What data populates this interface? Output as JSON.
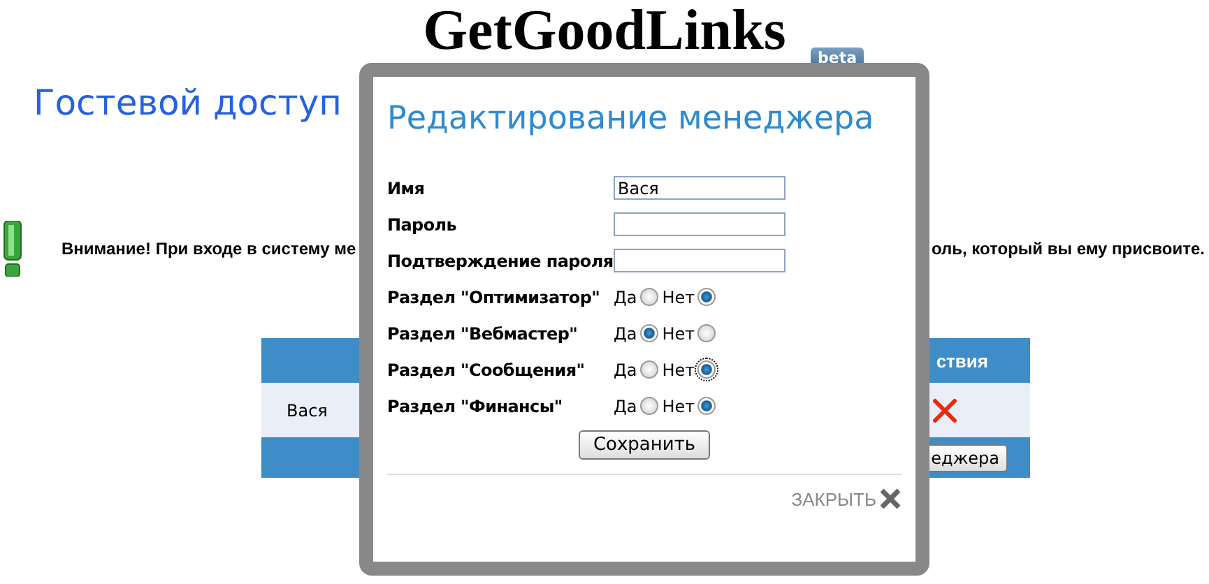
{
  "header": {
    "logo": "GetGoodLinks",
    "badge": "beta"
  },
  "page_title": "Гостевой доступ",
  "warning": {
    "text_left": "Внимание! При входе в систему ме",
    "text_right": "оль, который вы ему присвоите."
  },
  "table": {
    "header_text": "ствия",
    "rows": [
      {
        "name": "Вася"
      }
    ],
    "footer_button": "еджера"
  },
  "dialog": {
    "title": "Редактирование менеджера",
    "fields": [
      {
        "label": "Имя",
        "value": "Вася"
      },
      {
        "label": "Пароль"
      },
      {
        "label": "Подтверждение пароля"
      }
    ],
    "sections": [
      {
        "label": "Раздел \"Оптимизатор\"",
        "options": [
          {
            "label": "Да",
            "selected": false,
            "focused": false
          },
          {
            "label": "Нет",
            "selected": true,
            "focused": false
          }
        ]
      },
      {
        "label": "Раздел \"Вебмастер\"",
        "options": [
          {
            "label": "Да",
            "selected": true,
            "focused": false
          },
          {
            "label": "Нет",
            "selected": false,
            "focused": false
          }
        ]
      },
      {
        "label": "Раздел \"Сообщения\"",
        "options": [
          {
            "label": "Да",
            "selected": false,
            "focused": false
          },
          {
            "label": "Нет",
            "selected": true,
            "focused": true
          }
        ]
      },
      {
        "label": "Раздел \"Финансы\"",
        "options": [
          {
            "label": "Да",
            "selected": false,
            "focused": false
          },
          {
            "label": "Нет",
            "selected": true,
            "focused": false
          }
        ]
      }
    ],
    "save_button": "Сохранить",
    "close_label": "ЗАКРЫТЬ"
  }
}
